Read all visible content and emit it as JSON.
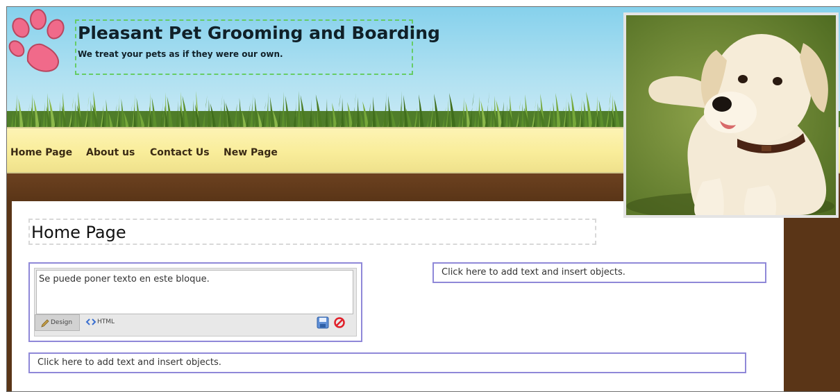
{
  "site": {
    "title": "Pleasant Pet Grooming and Boarding",
    "tagline": "We treat your pets as if they were our own."
  },
  "nav": {
    "items": [
      {
        "label": "Home Page"
      },
      {
        "label": "About us"
      },
      {
        "label": "Contact Us"
      },
      {
        "label": "New Page"
      }
    ]
  },
  "page": {
    "title": "Home Page"
  },
  "editor": {
    "text": "Se puede poner texto en este bloque.",
    "tab_design": "Design",
    "tab_html": "HTML",
    "save_icon": "save-icon",
    "cancel_icon": "cancel-icon"
  },
  "placeholders": {
    "right_block": "Click here to add text and insert objects.",
    "bottom_block": "Click here to add text and insert objects."
  },
  "colors": {
    "sky": "#86d1ec",
    "nav_bar": "#f9ed9a",
    "brown_band": "#5a3517",
    "block_border": "#8f88d8",
    "title_dash": "#66cc66",
    "paw": "#f06a8a"
  },
  "icons": {
    "logo": "paw-print-icon",
    "photo": "puppy-photo"
  }
}
